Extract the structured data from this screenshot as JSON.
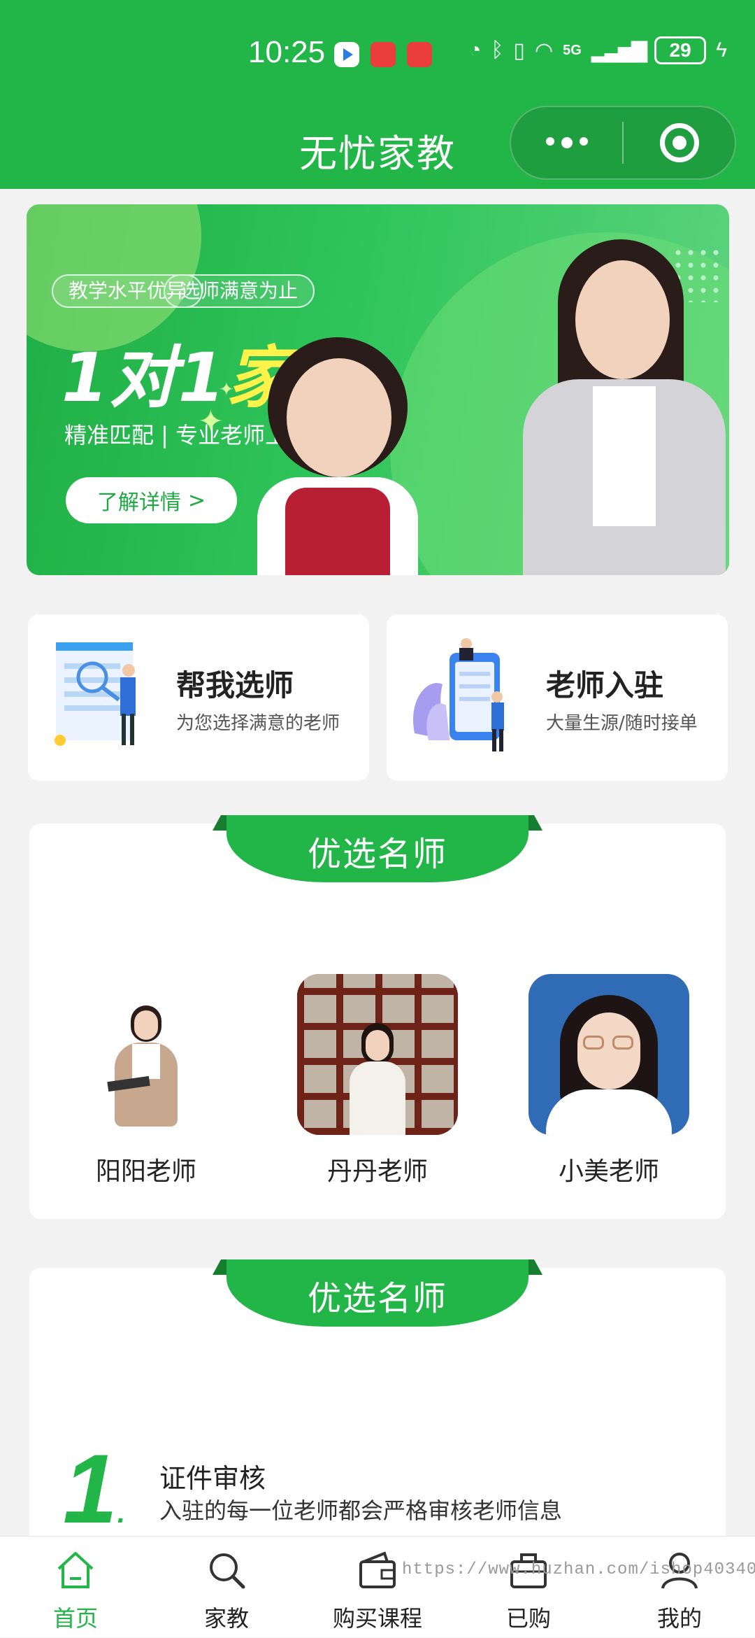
{
  "status": {
    "time": "10:25",
    "network": "5G",
    "battery": "29"
  },
  "navbar": {
    "title": "无忧家教"
  },
  "banner": {
    "tags": [
      "教学水平优异",
      "选师满意为止"
    ],
    "title_part1": "1对1",
    "title_part2": "家教",
    "subtitle": "精准匹配 | 专业老师上门辅导",
    "button": "了解详情",
    "button_arrow": ">"
  },
  "actions": [
    {
      "title": "帮我选师",
      "subtitle": "为您选择满意的老师"
    },
    {
      "title": "老师入驻",
      "subtitle": "大量生源/随时接单"
    }
  ],
  "teachers_section": {
    "title": "优选名师",
    "teachers": [
      {
        "name": "阳阳老师"
      },
      {
        "name": "丹丹老师"
      },
      {
        "name": "小美老师"
      }
    ]
  },
  "process_section": {
    "title": "优选名师",
    "steps": [
      {
        "number": "1",
        "title": "证件审核",
        "desc": "入驻的每一位老师都会严格审核老师信息"
      }
    ]
  },
  "tabbar": {
    "items": [
      {
        "label": "首页",
        "icon": "home-icon",
        "active": true
      },
      {
        "label": "家教",
        "icon": "search-icon",
        "active": false
      },
      {
        "label": "购买课程",
        "icon": "wallet-icon",
        "active": false
      },
      {
        "label": "已购",
        "icon": "briefcase-icon",
        "active": false
      },
      {
        "label": "我的",
        "icon": "user-icon",
        "active": false
      }
    ]
  },
  "watermark": "https://www.huzhan.com/ishop40340",
  "colors": {
    "brand": "#22b648",
    "accent_yellow": "#fff24a"
  }
}
